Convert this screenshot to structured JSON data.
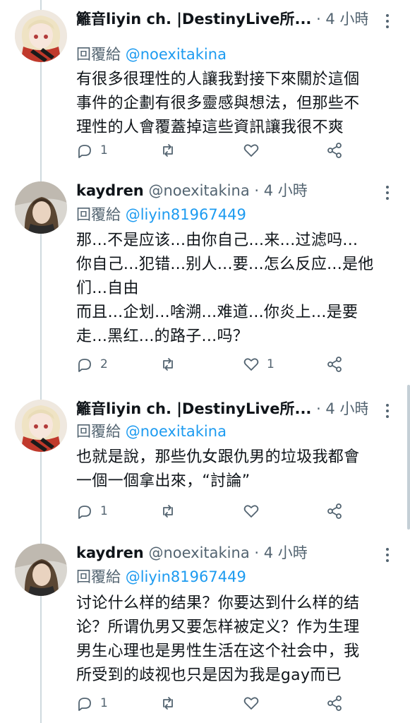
{
  "tweets": [
    {
      "name": "籬音liyin ch. |DestinyLive所...",
      "meta": " · 4 小時",
      "reply_prefix": "回覆給 ",
      "reply_handle": "@noexitakina",
      "text": "有很多很理性的人讓我對接下來關於這個\n事件的企劃有很多靈感與想法，但那些不\n理性的人會覆蓋掉這些資訊讓我很不爽",
      "reply_count": "1",
      "retweet_count": "",
      "like_count": "",
      "avatar": "anime-girl-avatar"
    },
    {
      "name": "kaydren",
      "meta": " @noexitakina · 4 小時",
      "reply_prefix": "回覆給 ",
      "reply_handle": "@liyin81967449",
      "text": "那...不是应该...由你自己...来...过滤吗...\n你自己...犯错...别人...要...怎么反应...是他\n们...自由\n而且...企划...啥溯...难道...你炎上...是要\n走...黑红...的路子...吗？",
      "reply_count": "2",
      "retweet_count": "",
      "like_count": "1",
      "avatar": "photo-avatar"
    },
    {
      "name": "籬音liyin ch. |DestinyLive所...",
      "meta": " · 4 小時",
      "reply_prefix": "回覆給 ",
      "reply_handle": "@noexitakina",
      "text": "也就是說，那些仇女跟仇男的垃圾我都會\n一個一個拿出來，“討論”",
      "reply_count": "1",
      "retweet_count": "",
      "like_count": "",
      "avatar": "anime-girl-avatar"
    },
    {
      "name": "kaydren",
      "meta": " @noexitakina · 4 小時",
      "reply_prefix": "回覆給 ",
      "reply_handle": "@liyin81967449",
      "text": "讨论什么样的结果？你要达到什么样的结\n论？所谓仇男又要怎样被定义？作为生理\n男生心理也是男性生活在这个社会中，我\n所受到的歧视也只是因为我是gay而已",
      "reply_count": "1",
      "retweet_count": "",
      "like_count": "",
      "avatar": "photo-avatar"
    }
  ],
  "colors": {
    "accent": "#1d9bf0",
    "muted": "#536471",
    "text": "#0f1419",
    "thread_line": "#cfd9de"
  }
}
